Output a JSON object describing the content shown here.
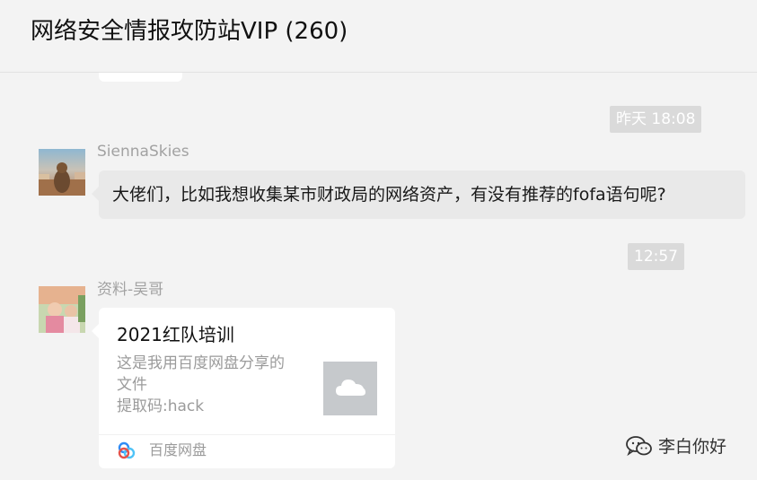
{
  "header": {
    "title": "网络安全情报攻防站VIP (260)"
  },
  "messages": {
    "time_1": "昨天 18:08",
    "msg_1": {
      "sender": "SiennaSkies",
      "text": "大佬们，比如我想收集某市财政局的网络资产，有没有推荐的fofa语句呢?"
    },
    "time_2": "12:57",
    "msg_2": {
      "sender": "资料-吴哥",
      "card": {
        "title": "2021红队培训",
        "desc_line1": "这是我用百度网盘分享的",
        "desc_line2": "文件",
        "desc_line3": "提取码:hack",
        "source": "百度网盘",
        "thumb_icon": "cloud-icon",
        "source_icon": "baidu-netdisk-icon"
      }
    }
  },
  "watermark": {
    "text": "李白你好",
    "icon": "wechat-icon"
  },
  "colors": {
    "background": "#f3f3f3",
    "bubble_incoming": "#e9e9e9",
    "card": "#ffffff",
    "time_chip": "#dadada",
    "muted_text": "#a2a2a2"
  }
}
